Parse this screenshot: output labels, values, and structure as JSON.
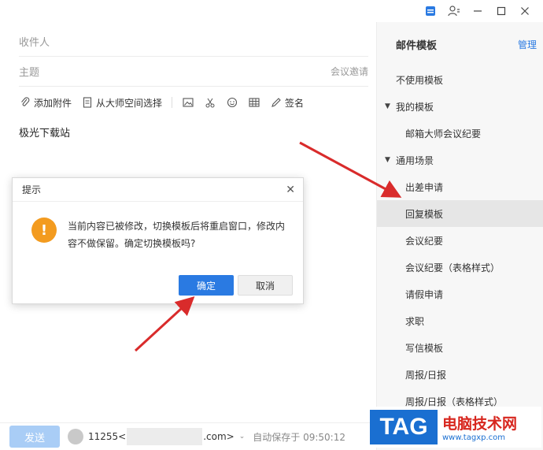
{
  "window": {
    "icons": [
      "app-icon",
      "user-switch-icon",
      "minimize-icon",
      "maximize-icon",
      "close-icon"
    ]
  },
  "compose": {
    "to_placeholder": "收件人",
    "subject_placeholder": "主题",
    "meeting_invite": "会议邀请",
    "toolbar": {
      "attach": "添加附件",
      "from_space": "从大师空间选择",
      "signature": "签名"
    },
    "body": "极光下载站"
  },
  "footer": {
    "send": "发送",
    "sender_prefix": "11255<",
    "sender_suffix": ".com>",
    "autosave": "自动保存于 09:50:12"
  },
  "sidebar": {
    "title": "邮件模板",
    "manage": "管理",
    "no_template": "不使用模板",
    "my_group": "我的模板",
    "my_items": [
      "邮箱大师会议纪要"
    ],
    "common_group": "通用场景",
    "common_items": [
      "出差申请",
      "回复模板",
      "会议纪要",
      "会议纪要（表格样式）",
      "请假申请",
      "求职",
      "写信模板",
      "周报/日报",
      "周报/日报（表格样式）"
    ],
    "active_index": 1
  },
  "dialog": {
    "title": "提示",
    "message": "当前内容已被修改，切换模板后将重启窗口，修改内容不做保留。确定切换模板吗?",
    "ok": "确定",
    "cancel": "取消"
  },
  "watermark": {
    "tag": "TAG",
    "cn": "电脑技术网",
    "url": "www.tagxp.com"
  },
  "colors": {
    "accent": "#2a7ae2",
    "warn": "#f39b1f",
    "arrow": "#d92b2b"
  }
}
